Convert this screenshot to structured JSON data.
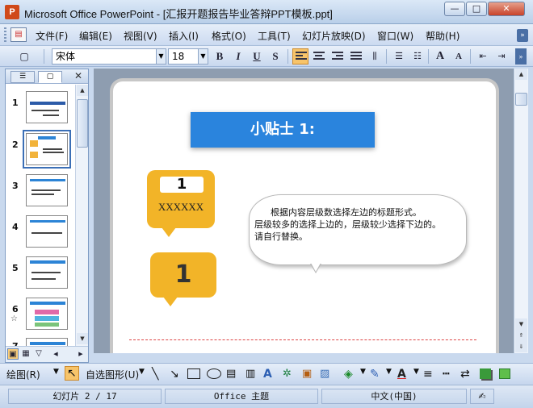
{
  "window": {
    "title": "Microsoft Office PowerPoint - [汇报开题报告毕业答辩PPT模板.ppt]",
    "app_icon": "powerpoint-icon",
    "min_label": "—",
    "max_label": "□",
    "close_label": "✕"
  },
  "menu": {
    "items": [
      "文件(F)",
      "编辑(E)",
      "视图(V)",
      "插入(I)",
      "格式(O)",
      "工具(T)",
      "幻灯片放映(D)",
      "窗口(W)",
      "帮助(H)"
    ]
  },
  "toolbar": {
    "font_name": "宋体",
    "font_size": "18",
    "bold": "B",
    "italic": "I",
    "underline": "U",
    "shadow": "S",
    "grow_font": "A",
    "shrink_font": "A"
  },
  "left_pane": {
    "tab_outline_icon": "outline-icon",
    "tab_slides_icon": "slides-icon",
    "close_label": "✕",
    "slide_numbers": [
      "1",
      "2",
      "3",
      "4",
      "5",
      "6",
      "7"
    ],
    "selected_slide": "2"
  },
  "slide": {
    "banner_title": "小贴士 1:",
    "bubble1_number": "1",
    "bubble1_text": "XXXXXX",
    "bubble2_number": "1",
    "note_lines": [
      "根据内容层级数选择左边的标题形式。",
      "层级较多的选择上边的，层级较少选择下边的。",
      "请自行替换。"
    ]
  },
  "drawing_toolbar": {
    "draw_label": "绘图(R)",
    "autoshapes_label": "自选图形(U)"
  },
  "status": {
    "slide_info": "幻灯片 2 / 17",
    "theme": "Office 主题",
    "language": "中文(中国)"
  },
  "colors": {
    "banner": "#2a84dd",
    "bubble": "#f2b428",
    "selection": "#3b6fb6"
  }
}
